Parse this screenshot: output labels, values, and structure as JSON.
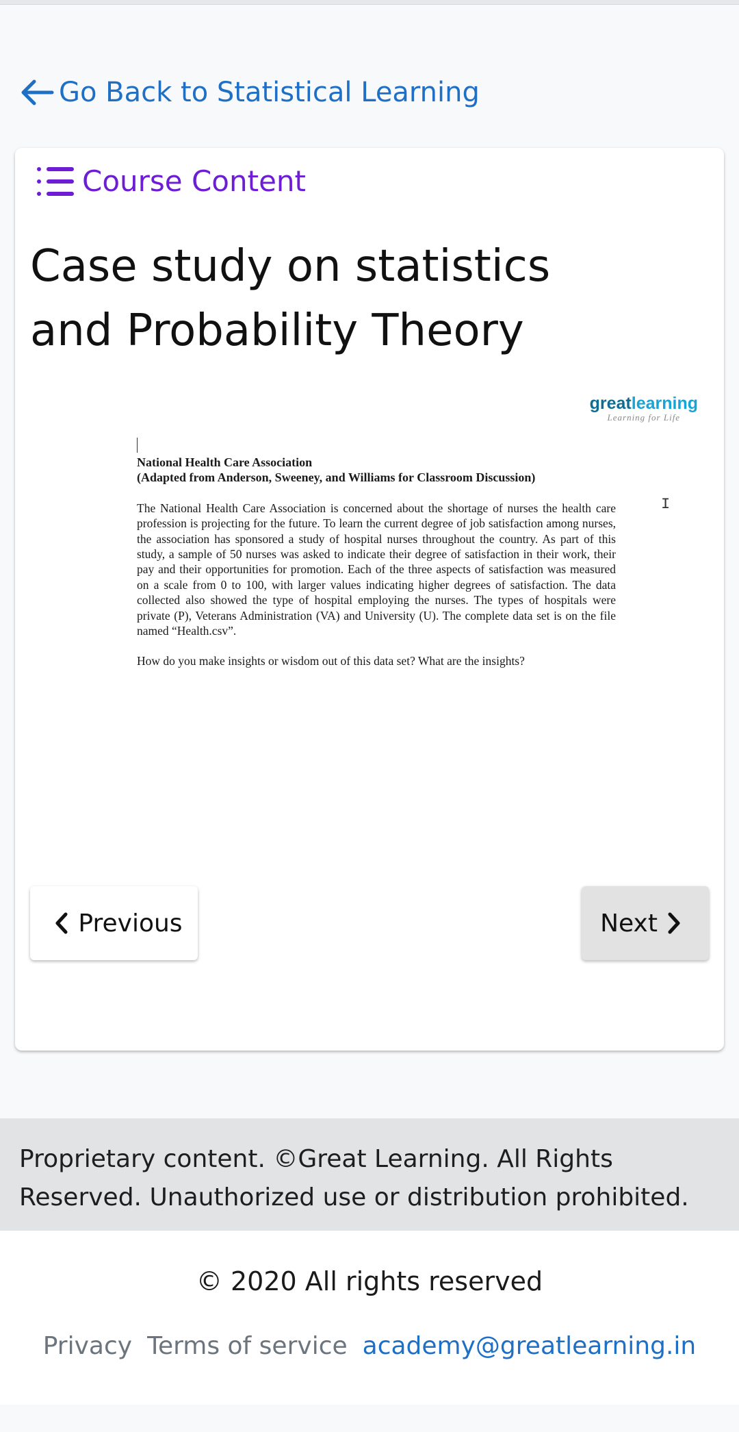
{
  "nav": {
    "back_label": "Go Back to Statistical Learning"
  },
  "card": {
    "course_content_label": "Course Content",
    "title": "Case study on statistics and Probability Theory"
  },
  "document": {
    "logo_brand_dark": "great",
    "logo_brand_light": "learning",
    "logo_tagline": "Learning for Life",
    "heading_line1": "National Health Care Association",
    "heading_line2": "(Adapted from Anderson, Sweeney, and Williams for Classroom Discussion)",
    "paragraph": "The National Health Care Association is concerned about the shortage of nurses the health care profession is projecting for the future. To learn the current degree of job satisfaction among nurses, the association has sponsored a study of hospital nurses throughout the country. As part of this study, a sample of 50 nurses was asked to indicate their degree of satisfaction in their work, their pay and their opportunities for promotion. Each of the three aspects of satisfaction was measured on a scale from 0 to 100, with larger values indicating higher degrees of satisfaction. The data collected also showed the type of hospital employing the nurses. The types of hospitals were private (P), Veterans Administration (VA) and University (U). The complete data set is on the file named “Health.csv”.",
    "question": "How do you make insights or wisdom out of this data set? What are the insights?"
  },
  "pagination": {
    "previous_label": "Previous",
    "next_label": "Next"
  },
  "notice": {
    "text": "Proprietary content. ©Great Learning. All Rights Reserved. Unauthorized use or distribution prohibited."
  },
  "footer": {
    "copyright": "© 2020 All rights reserved",
    "privacy_label": "Privacy",
    "terms_label": "Terms of service",
    "email_label": "academy@greatlearning.in"
  },
  "colors": {
    "link_blue": "#1f6fc5",
    "course_purple": "#6d1ed4",
    "logo_teal": "#0e6d93"
  },
  "icons": {
    "back": "arrow-left-icon",
    "course_content": "list-icon",
    "previous": "chevron-left-icon",
    "next": "chevron-right-icon"
  }
}
